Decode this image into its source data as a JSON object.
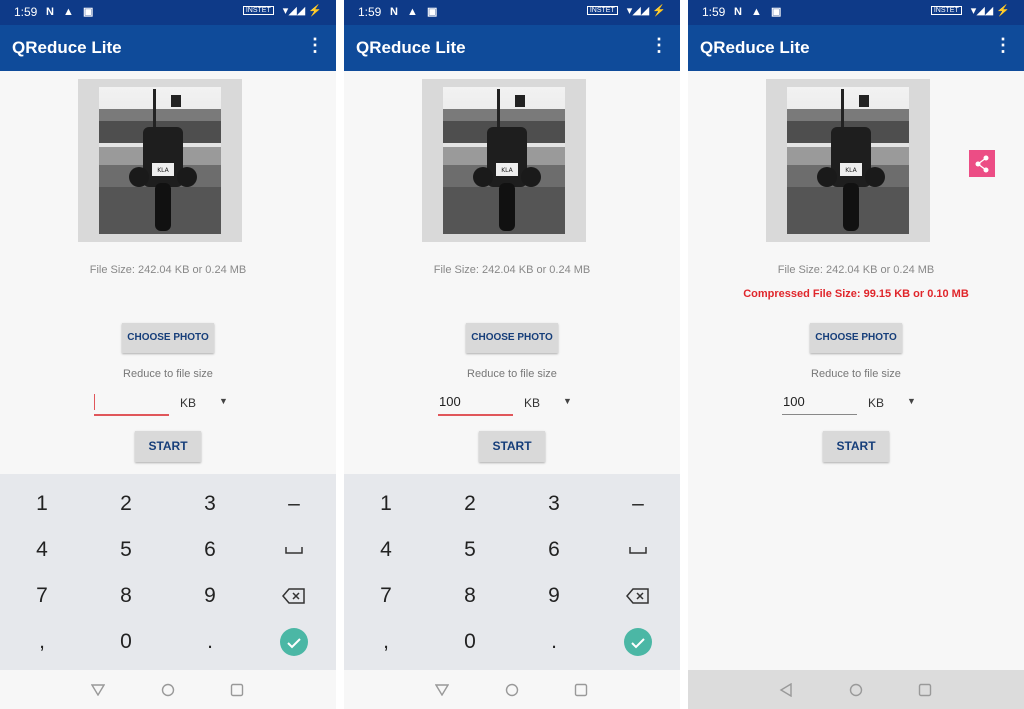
{
  "status_bar": {
    "time": "1:59",
    "carrier": "INSTET"
  },
  "app": {
    "title": "QReduce Lite",
    "menu_icon": "more-vertical-icon"
  },
  "main": {
    "file_size": "File Size: 242.04 KB or 0.24 MB",
    "compressed_size": "Compressed File Size: 99.15 KB or 0.10 MB",
    "choose_photo": "CHOOSE PHOTO",
    "reduce_label": "Reduce to file size",
    "unit": "KB",
    "start": "START"
  },
  "screens": [
    {
      "input_value": "",
      "input_focused": true,
      "keyboard": true
    },
    {
      "input_value": "100",
      "input_focused": true,
      "keyboard": true
    },
    {
      "input_value": "100",
      "input_focused": false,
      "keyboard": false
    }
  ],
  "keyboard": {
    "keys": [
      [
        "1",
        "2",
        "3",
        "–"
      ],
      [
        "4",
        "5",
        "6",
        "space-icon"
      ],
      [
        "7",
        "8",
        "9",
        "backspace-icon"
      ],
      [
        ",",
        "0",
        ".",
        "done-check-icon"
      ]
    ]
  },
  "colors": {
    "status_bar": "#0e3a88",
    "app_bar": "#0f4b9a",
    "compressed_text": "#e0262b",
    "input_focus": "#e0565a",
    "share_button": "#ec4d85",
    "done_key": "#4bb7a5"
  }
}
